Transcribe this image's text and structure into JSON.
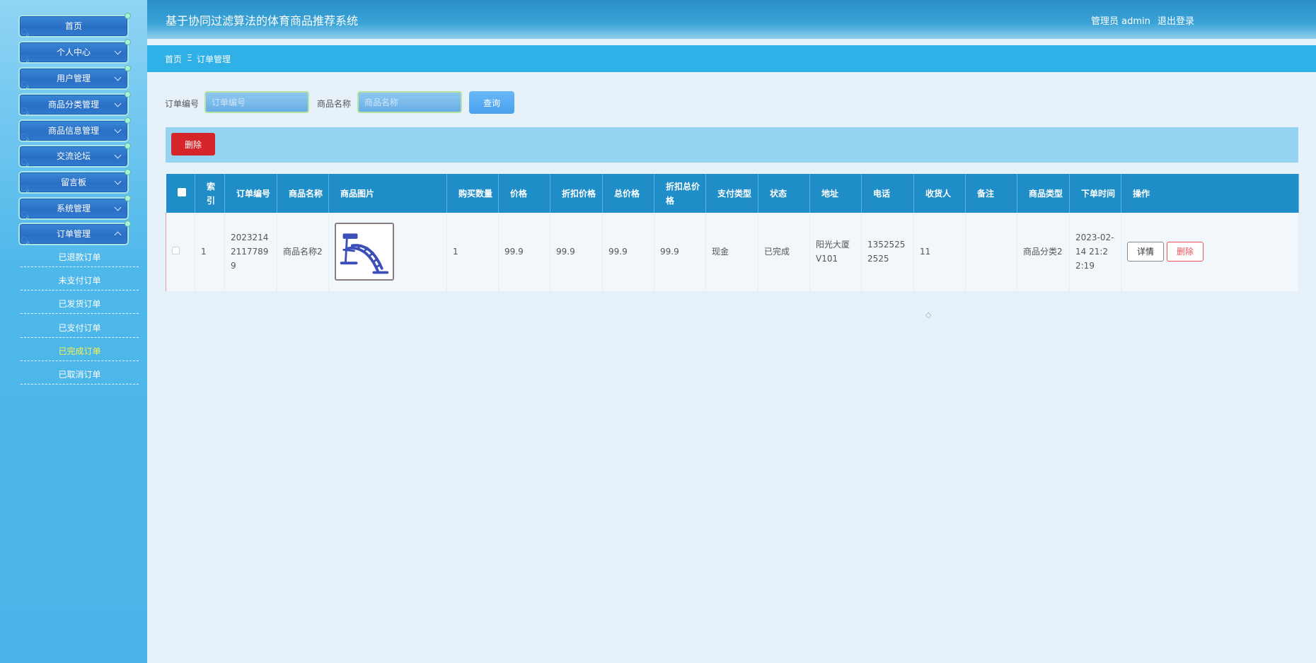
{
  "header": {
    "title": "基于协同过滤算法的体育商品推荐系统",
    "user": "管理员 admin",
    "logout": "退出登录"
  },
  "breadcrumb": {
    "home": "首页",
    "separator": "Ξ",
    "current": "订单管理"
  },
  "sidebar": {
    "menu": [
      {
        "label": "首页"
      },
      {
        "label": "个人中心"
      },
      {
        "label": "用户管理"
      },
      {
        "label": "商品分类管理"
      },
      {
        "label": "商品信息管理"
      },
      {
        "label": "交流论坛"
      },
      {
        "label": "留言板"
      },
      {
        "label": "系统管理"
      },
      {
        "label": "订单管理"
      }
    ],
    "sub_items": [
      {
        "label": "已退款订单"
      },
      {
        "label": "未支付订单"
      },
      {
        "label": "已发货订单"
      },
      {
        "label": "已支付订单"
      },
      {
        "label": "已完成订单"
      },
      {
        "label": "已取消订单"
      }
    ],
    "active_sub": "已完成订单"
  },
  "search": {
    "order_label": "订单编号",
    "order_placeholder": "订单编号",
    "product_label": "商品名称",
    "product_placeholder": "商品名称",
    "query_button": "查询"
  },
  "actions": {
    "delete_button": "删除"
  },
  "table": {
    "headers": {
      "index": "索引",
      "order_no": "订单编号",
      "product_name": "商品名称",
      "product_image": "商品图片",
      "quantity": "购买数量",
      "price": "价格",
      "discount_price": "折扣价格",
      "total_price": "总价格",
      "discount_total": "折扣总价格",
      "pay_type": "支付类型",
      "status": "状态",
      "address": "地址",
      "phone": "电话",
      "consignee": "收货人",
      "remark": "备注",
      "category": "商品类型",
      "order_time": "下单时间",
      "operation": "操作"
    },
    "rows": [
      {
        "index": "1",
        "order_no": "202321421177899",
        "product_name": "商品名称2",
        "quantity": "1",
        "price": "99.9",
        "discount_price": "99.9",
        "total_price": "99.9",
        "discount_total": "99.9",
        "pay_type": "现金",
        "status": "已完成",
        "address": "阳光大厦V101",
        "phone": "13525252525",
        "consignee": "11",
        "remark": "",
        "category": "商品分类2",
        "order_time": "2023-02-14 21:22:19",
        "detail_button": "详情",
        "delete_button": "删除"
      }
    ]
  },
  "colors": {
    "header": "#2a8fc6",
    "breadcrumb": "#2fb0e6",
    "table_header": "#1f8ec8",
    "delete": "#d6252a",
    "active_sub": "#f7f34a"
  }
}
